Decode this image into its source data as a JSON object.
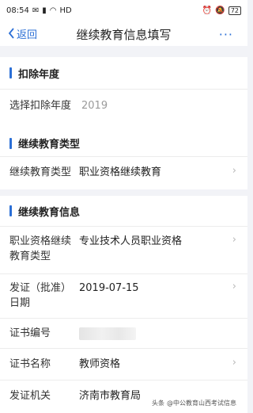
{
  "status_bar": {
    "time": "08:54",
    "network": "HD",
    "battery": "72"
  },
  "nav": {
    "back_label": "返回",
    "title": "继续教育信息填写",
    "more": "···"
  },
  "deduction_year": {
    "header": "扣除年度",
    "rows": [
      {
        "label": "选择扣除年度",
        "value": "2019"
      }
    ]
  },
  "education_type": {
    "header": "继续教育类型",
    "rows": [
      {
        "label": "继续教育类型",
        "value": "职业资格继续教育"
      }
    ]
  },
  "education_info": {
    "header": "继续教育信息",
    "rows": [
      {
        "label": "职业资格继续教育类型",
        "value": "专业技术人员职业资格"
      },
      {
        "label": "发证（批准）日期",
        "value": "2019-07-15"
      },
      {
        "label": "证书编号",
        "value": ""
      },
      {
        "label": "证书名称",
        "value": "教师资格"
      },
      {
        "label": "发证机关",
        "value": "济南市教育局"
      }
    ]
  },
  "watermark": {
    "prefix": "头条",
    "text": "@中公教育山西考试信息"
  },
  "colors": {
    "accent": "#2b6fd6",
    "background": "#f2f3f7"
  }
}
